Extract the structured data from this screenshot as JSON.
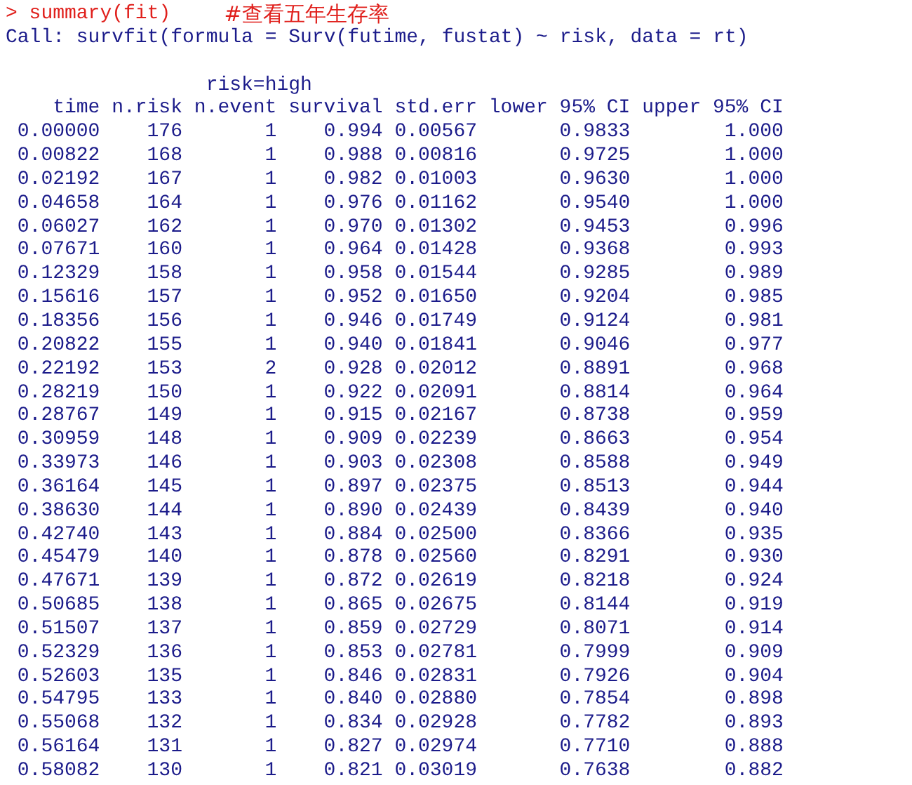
{
  "console": {
    "command": "> summary(fit)",
    "comment": "#查看五年生存率",
    "call": "Call: survfit(formula = Surv(futime, fustat) ~ risk, data = rt)",
    "strata": "risk=high"
  },
  "table": {
    "columns": [
      "time",
      "n.risk",
      "n.event",
      "survival",
      "std.err",
      "lower 95% CI",
      "upper 95% CI"
    ],
    "rows": [
      [
        "0.00000",
        "176",
        "1",
        "0.994",
        "0.00567",
        "0.9833",
        "1.000"
      ],
      [
        "0.00822",
        "168",
        "1",
        "0.988",
        "0.00816",
        "0.9725",
        "1.000"
      ],
      [
        "0.02192",
        "167",
        "1",
        "0.982",
        "0.01003",
        "0.9630",
        "1.000"
      ],
      [
        "0.04658",
        "164",
        "1",
        "0.976",
        "0.01162",
        "0.9540",
        "1.000"
      ],
      [
        "0.06027",
        "162",
        "1",
        "0.970",
        "0.01302",
        "0.9453",
        "0.996"
      ],
      [
        "0.07671",
        "160",
        "1",
        "0.964",
        "0.01428",
        "0.9368",
        "0.993"
      ],
      [
        "0.12329",
        "158",
        "1",
        "0.958",
        "0.01544",
        "0.9285",
        "0.989"
      ],
      [
        "0.15616",
        "157",
        "1",
        "0.952",
        "0.01650",
        "0.9204",
        "0.985"
      ],
      [
        "0.18356",
        "156",
        "1",
        "0.946",
        "0.01749",
        "0.9124",
        "0.981"
      ],
      [
        "0.20822",
        "155",
        "1",
        "0.940",
        "0.01841",
        "0.9046",
        "0.977"
      ],
      [
        "0.22192",
        "153",
        "2",
        "0.928",
        "0.02012",
        "0.8891",
        "0.968"
      ],
      [
        "0.28219",
        "150",
        "1",
        "0.922",
        "0.02091",
        "0.8814",
        "0.964"
      ],
      [
        "0.28767",
        "149",
        "1",
        "0.915",
        "0.02167",
        "0.8738",
        "0.959"
      ],
      [
        "0.30959",
        "148",
        "1",
        "0.909",
        "0.02239",
        "0.8663",
        "0.954"
      ],
      [
        "0.33973",
        "146",
        "1",
        "0.903",
        "0.02308",
        "0.8588",
        "0.949"
      ],
      [
        "0.36164",
        "145",
        "1",
        "0.897",
        "0.02375",
        "0.8513",
        "0.944"
      ],
      [
        "0.38630",
        "144",
        "1",
        "0.890",
        "0.02439",
        "0.8439",
        "0.940"
      ],
      [
        "0.42740",
        "143",
        "1",
        "0.884",
        "0.02500",
        "0.8366",
        "0.935"
      ],
      [
        "0.45479",
        "140",
        "1",
        "0.878",
        "0.02560",
        "0.8291",
        "0.930"
      ],
      [
        "0.47671",
        "139",
        "1",
        "0.872",
        "0.02619",
        "0.8218",
        "0.924"
      ],
      [
        "0.50685",
        "138",
        "1",
        "0.865",
        "0.02675",
        "0.8144",
        "0.919"
      ],
      [
        "0.51507",
        "137",
        "1",
        "0.859",
        "0.02729",
        "0.8071",
        "0.914"
      ],
      [
        "0.52329",
        "136",
        "1",
        "0.853",
        "0.02781",
        "0.7999",
        "0.909"
      ],
      [
        "0.52603",
        "135",
        "1",
        "0.846",
        "0.02831",
        "0.7926",
        "0.904"
      ],
      [
        "0.54795",
        "133",
        "1",
        "0.840",
        "0.02880",
        "0.7854",
        "0.898"
      ],
      [
        "0.55068",
        "132",
        "1",
        "0.834",
        "0.02928",
        "0.7782",
        "0.893"
      ],
      [
        "0.56164",
        "131",
        "1",
        "0.827",
        "0.02974",
        "0.7710",
        "0.888"
      ],
      [
        "0.58082",
        "130",
        "1",
        "0.821",
        "0.03019",
        "0.7638",
        "0.882"
      ]
    ]
  }
}
